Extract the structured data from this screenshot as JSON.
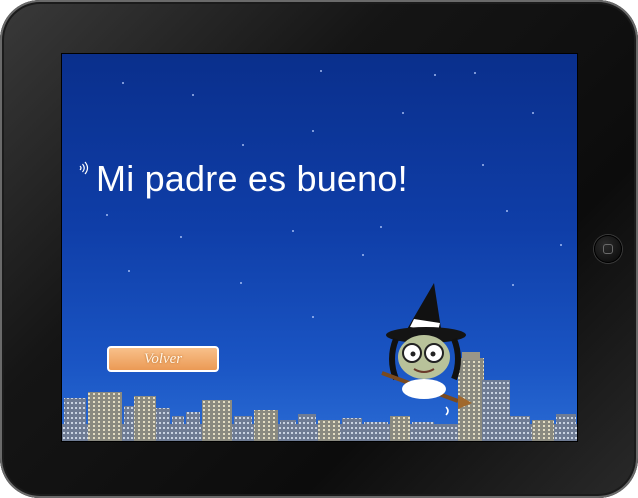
{
  "screen": {
    "title": "Mi padre es bueno!",
    "back_button_label": "Volver",
    "icons": {
      "audio": "speaker-icon",
      "character": "witch-on-broom",
      "background": "night-city-skyline"
    },
    "colors": {
      "sky_top": "#0a2f8c",
      "sky_bottom": "#2a6bd4",
      "button": "#eb9a55"
    }
  }
}
